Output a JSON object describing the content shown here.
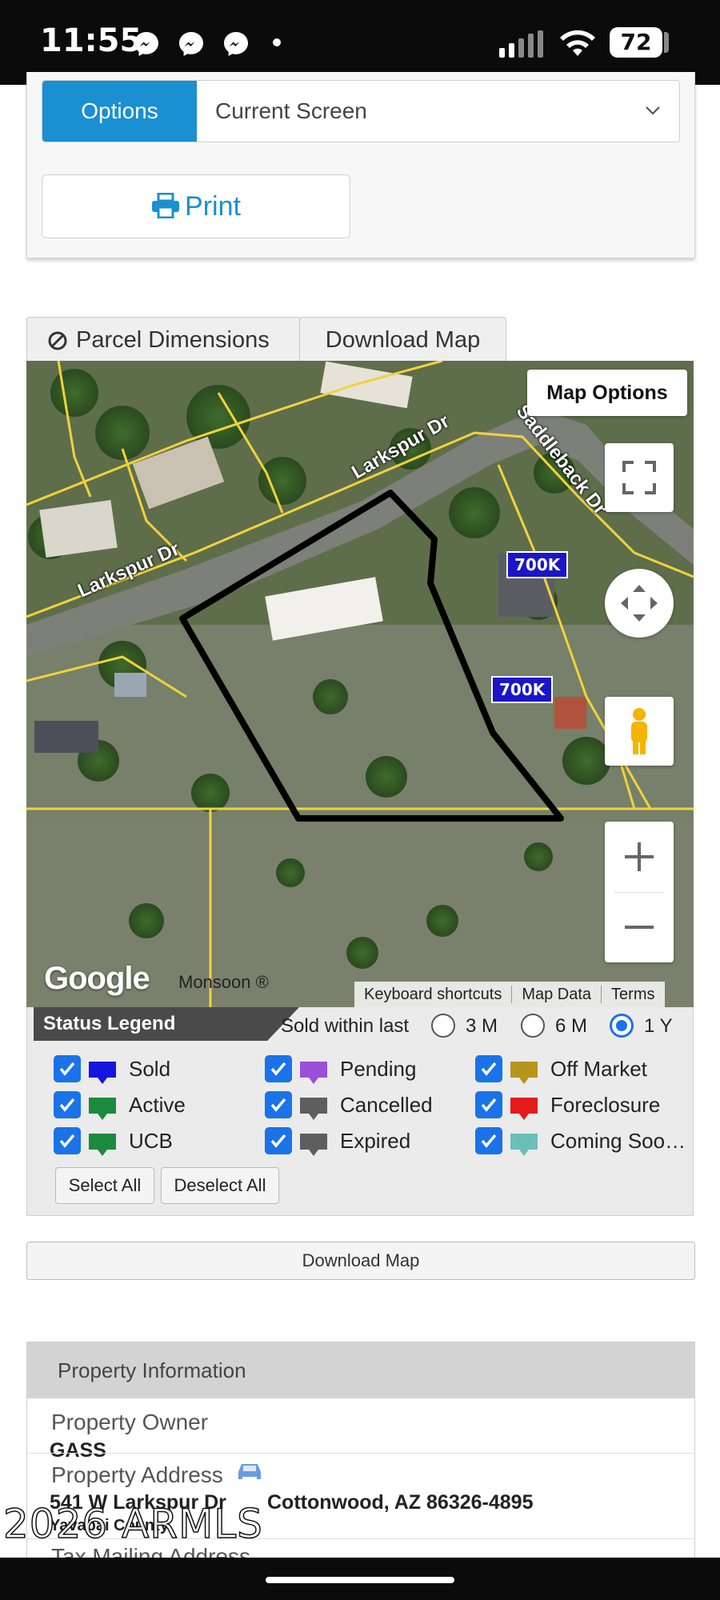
{
  "status_bar": {
    "time": "11:55",
    "battery": "72",
    "icons": [
      "messenger-icon",
      "messenger-icon",
      "messenger-icon",
      "signal-icon",
      "wifi-icon",
      "battery-icon"
    ]
  },
  "controls": {
    "options_label": "Options",
    "select_value": "Current Screen",
    "print_label": "Print"
  },
  "tabs": {
    "parcel_dimensions": "Parcel Dimensions",
    "download_map": "Download Map"
  },
  "map": {
    "options_button": "Map Options",
    "streets": [
      "Larkspur Dr",
      "Larkspur Dr",
      "Saddleback Dr"
    ],
    "price_badges": [
      "700K",
      "700K"
    ],
    "google_logo": "Google",
    "provider": "Monsoon ®",
    "attribution": [
      "Keyboard shortcuts",
      "Map Data",
      "Terms"
    ],
    "colors": {
      "parcel_lines": "#f2d23c",
      "selected_parcel": "#000000",
      "badge": "#1a16c8"
    }
  },
  "legend": {
    "title": "Status Legend",
    "sold_within": "Sold within last",
    "periods": [
      {
        "label": "3 M",
        "selected": false
      },
      {
        "label": "6 M",
        "selected": false
      },
      {
        "label": "1 Y",
        "selected": true
      }
    ],
    "items": [
      {
        "label": "Sold",
        "color": "#1515e0",
        "checked": true
      },
      {
        "label": "Pending",
        "color": "#9a4fd6",
        "checked": true
      },
      {
        "label": "Off Market",
        "color": "#b5951c",
        "checked": true
      },
      {
        "label": "Active",
        "color": "#1c8a3c",
        "checked": true
      },
      {
        "label": "Cancelled",
        "color": "#5e5e5e",
        "checked": true
      },
      {
        "label": "Foreclosure",
        "color": "#e51b1b",
        "checked": true
      },
      {
        "label": "UCB",
        "color": "#1c8a3c",
        "checked": true
      },
      {
        "label": "Expired",
        "color": "#5e5e5e",
        "checked": true
      },
      {
        "label": "Coming Soo…",
        "color": "#6ac0b8",
        "checked": true
      }
    ],
    "select_all": "Select All",
    "deselect_all": "Deselect All"
  },
  "download_map_button": "Download Map",
  "property_info": {
    "header": "Property Information",
    "owner_label": "Property Owner",
    "owner_value": "GASS",
    "address_label": "Property Address",
    "address_street": "541 W Larkspur Dr",
    "address_city": "Cottonwood, AZ 86326-4895",
    "partial_line": "Yavapai County",
    "tax_label": "Tax Mailing Address"
  },
  "watermark": "2026 ARMLS"
}
